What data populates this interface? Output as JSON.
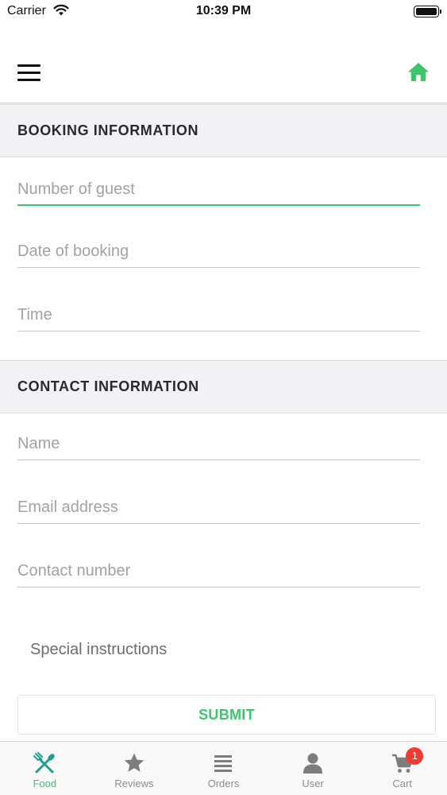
{
  "status_bar": {
    "carrier": "Carrier",
    "time": "10:39 PM"
  },
  "nav": {
    "menu_icon": "hamburger-menu-icon",
    "home_icon": "home-icon",
    "accent_color": "#3dc46d"
  },
  "booking_section": {
    "title": "BOOKING INFORMATION",
    "fields": [
      {
        "placeholder": "Number of guest",
        "value": "",
        "focused": true
      },
      {
        "placeholder": "Date of booking",
        "value": ""
      },
      {
        "placeholder": "Time",
        "value": ""
      }
    ]
  },
  "contact_section": {
    "title": "CONTACT INFORMATION",
    "fields": [
      {
        "placeholder": "Name",
        "value": ""
      },
      {
        "placeholder": "Email address",
        "value": ""
      },
      {
        "placeholder": "Contact number",
        "value": ""
      }
    ]
  },
  "special_instructions": {
    "placeholder": "Special instructions",
    "value": ""
  },
  "submit": {
    "label": "SUBMIT"
  },
  "tab_bar": {
    "tabs": [
      {
        "label": "Food",
        "icon": "fork-knife-icon",
        "active": true
      },
      {
        "label": "Reviews",
        "icon": "star-icon"
      },
      {
        "label": "Orders",
        "icon": "list-icon"
      },
      {
        "label": "User",
        "icon": "user-icon"
      },
      {
        "label": "Cart",
        "icon": "cart-icon",
        "badge": "1"
      }
    ]
  },
  "colors": {
    "accent": "#3dc46d",
    "badge": "#f23a33",
    "section_bg": "#f2f2f4",
    "inactive": "#8e8e8e"
  }
}
